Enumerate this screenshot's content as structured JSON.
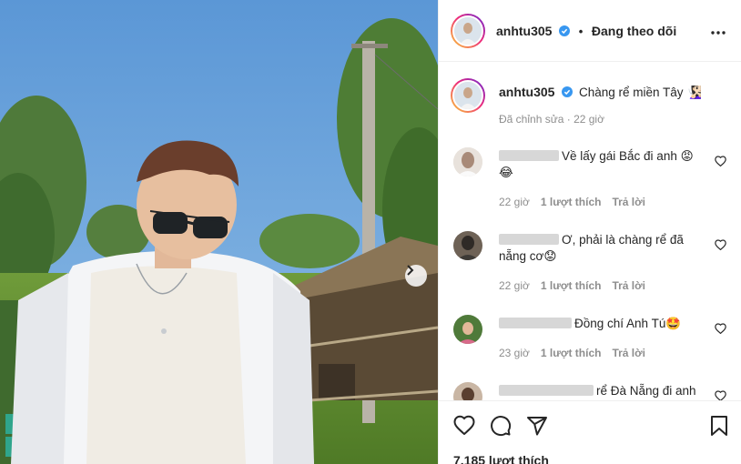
{
  "post": {
    "username": "anhtu305",
    "follow_status": "Đang theo dõi",
    "caption": "Chàng rể miền Tây 🧏🏻‍♀️",
    "caption_meta": "Đã chỉnh sửa · 22 giờ",
    "likes": "7.185 lượt thích"
  },
  "comments": [
    {
      "text": "Về lấy gái Bắc đi anh 😡",
      "text_line2": "😂",
      "time": "22 giờ",
      "likes": "1 lượt thích",
      "reply": "Trả lời"
    },
    {
      "text": "Ơ, phải là chàng rể đã",
      "text_line2": "nẵng cơ😟",
      "time": "22 giờ",
      "likes": "1 lượt thích",
      "reply": "Trả lời"
    },
    {
      "text": "Đồng chí Anh Tú🤩",
      "time": "23 giờ",
      "likes": "1 lượt thích",
      "reply": "Trả lời"
    },
    {
      "text": "rể Đà Nẵng đi anh"
    }
  ],
  "colors": {
    "verified": "#3897f0",
    "meta": "#8e8e8e",
    "divider": "#efefef"
  },
  "icons": [
    "more-icon",
    "heart-icon",
    "comment-icon",
    "share-icon",
    "save-icon",
    "chevron-right-icon",
    "verified-icon"
  ]
}
